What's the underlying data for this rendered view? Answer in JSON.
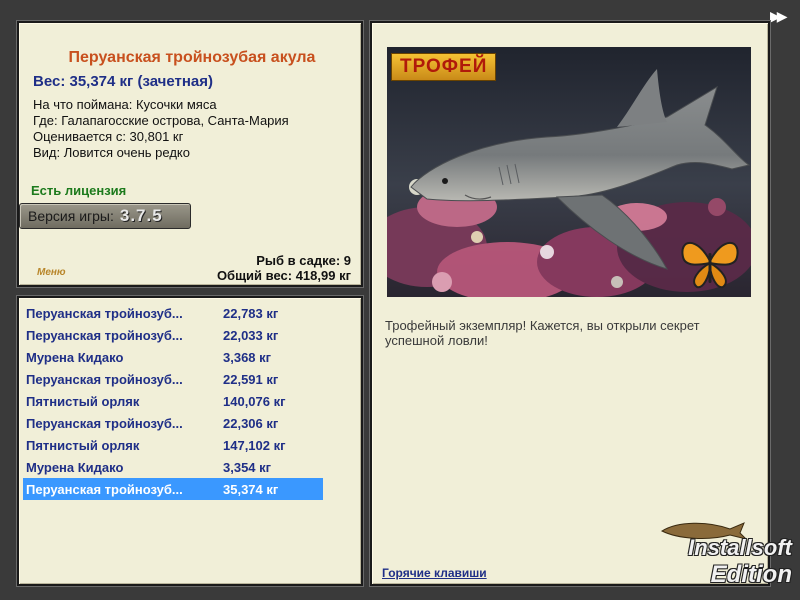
{
  "info": {
    "title": "Перуанская тройнозубая акула",
    "weight": "Вес: 35,374 кг (зачетная)",
    "caught_on": "На что поймана: Кусочки мяса",
    "where": "Где: Галапагосские острова, Санта-Мария",
    "rated_from": "Оценивается с: 30,801 кг",
    "kind": "Вид: Ловится очень редко",
    "license": "Есть лицензия",
    "version_label": "Версия игры:",
    "version_number": "3.7.5",
    "fish_in_keepnet": "Рыб в садке: 9",
    "total_weight": "Общий вес: 418,99 кг",
    "small_logo": "Меню"
  },
  "catches": [
    {
      "name": "Перуанская тройнозуб...",
      "weight": "22,783 кг"
    },
    {
      "name": "Перуанская тройнозуб...",
      "weight": "22,033 кг"
    },
    {
      "name": "Мурена Кидако",
      "weight": "3,368 кг"
    },
    {
      "name": "Перуанская тройнозуб...",
      "weight": "22,591 кг"
    },
    {
      "name": "Пятнистый орляк",
      "weight": "140,076 кг"
    },
    {
      "name": "Перуанская тройнозуб...",
      "weight": "22,306 кг"
    },
    {
      "name": "Пятнистый орляк",
      "weight": "147,102 кг"
    },
    {
      "name": "Мурена Кидако",
      "weight": "3,354 кг"
    },
    {
      "name": "Перуанская тройнозуб...",
      "weight": "35,374 кг"
    }
  ],
  "selected_catch_index": 8,
  "detail": {
    "trophy_label": "ТРОФЕЙ",
    "description": "Трофейный экземпляр! Кажется, вы открыли секрет успешной ловли!",
    "hotkeys_link": "Горячие клавиши"
  },
  "watermark": {
    "line1": "Installsoft",
    "line2": "Edition"
  },
  "icons": {
    "fast_forward": "fast-forward-icon",
    "butterfly": "butterfly-icon",
    "shark": "shark-image"
  },
  "colors": {
    "panel_bg": "#f1efd8",
    "title": "#c8501e",
    "list_text": "#1f2f87",
    "selected_row": "#3a98ff",
    "license": "#1c7a1c"
  }
}
